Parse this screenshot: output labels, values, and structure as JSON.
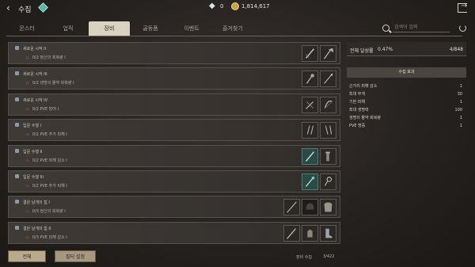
{
  "header": {
    "title": "수집",
    "currency_diamond": "0",
    "currency_gold": "1,814,617"
  },
  "tabs": [
    {
      "label": "몬스터",
      "active": false
    },
    {
      "label": "업적",
      "active": false
    },
    {
      "label": "장비",
      "active": true
    },
    {
      "label": "골동품",
      "active": false
    },
    {
      "label": "이벤트",
      "active": false
    },
    {
      "label": "즐겨찾기",
      "active": false
    }
  ],
  "search": {
    "placeholder": "검색어 입력"
  },
  "rows": [
    {
      "title": "새로운 시작 II",
      "progress": "0/2 정신의 회복량 I",
      "slots": [
        "sword",
        "axe"
      ]
    },
    {
      "title": "새로운 시작 III",
      "progress": "0/2 생명의 물약 회복량 I",
      "slots": [
        "mace",
        "spear"
      ]
    },
    {
      "title": "새로운 시작 IV",
      "progress": "0/2 PVE 방어 I",
      "slots": [
        "crossbow",
        "bow"
      ]
    },
    {
      "title": "입문 수행 I",
      "progress": "0/2 PVE 추가 피해 I",
      "slots": [
        "daggers",
        "claws"
      ]
    },
    {
      "title": "입문 수행 II",
      "progress": "0/2 PVE 피해 감소 I",
      "slots": [
        "blade-teal",
        "scroll"
      ]
    },
    {
      "title": "입문 수행 III",
      "progress": "0/2 PVE 추가 피해 I",
      "slots": [
        "staff-teal",
        "key"
      ]
    },
    {
      "title": "결은 날개의 힘 I",
      "progress": "0/3 정신의 회복량 I",
      "slots": [
        "spear",
        "helmet",
        "armor"
      ]
    },
    {
      "title": "결은 날개의 힘 II",
      "progress": "0/3 PVE 피해 감소 I",
      "slots": [
        "lance",
        "gauntlet",
        "boots"
      ]
    }
  ],
  "panel": {
    "rate_label": "전체 달성률",
    "rate_value": "0.47%",
    "count": "4/848",
    "effect_header": "수집 효과",
    "effects": [
      {
        "name": "근거리 피해 감소",
        "value": "1"
      },
      {
        "name": "최대 무게",
        "value": "30"
      },
      {
        "name": "기본 피해",
        "value": "1"
      },
      {
        "name": "최대 생명력",
        "value": "100"
      },
      {
        "name": "생명의 물약 회복량",
        "value": "1"
      },
      {
        "name": "PVE 명중",
        "value": "1"
      }
    ]
  },
  "bottom": {
    "all_button": "전체",
    "filter_button": "필터 설정",
    "collect_label": "장비 수집",
    "collect_count": "3/422"
  },
  "colors": {
    "active_tab": "#d9d2c0",
    "teal_slot": "#2a4a46",
    "gold": "#c9a34e"
  }
}
